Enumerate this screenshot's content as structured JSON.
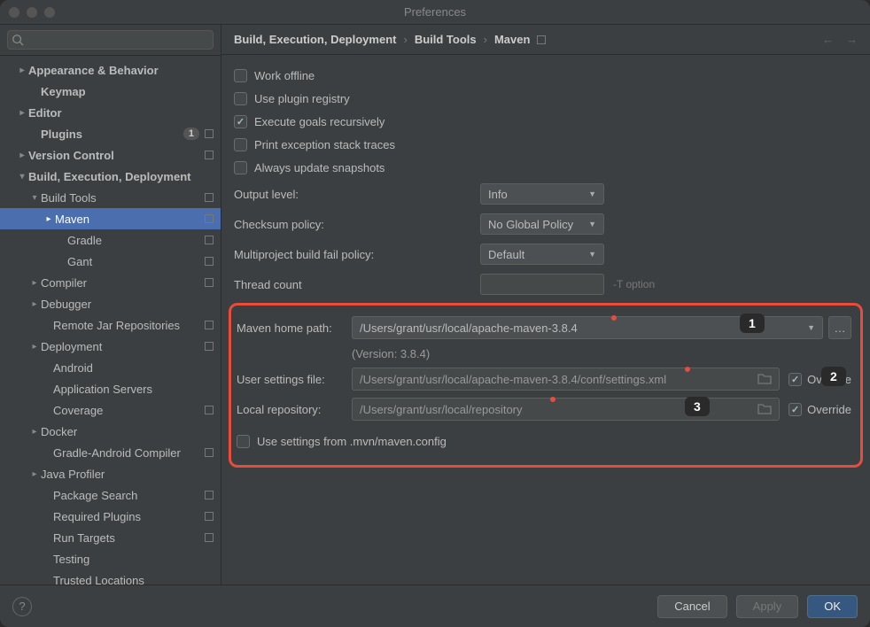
{
  "window": {
    "title": "Preferences"
  },
  "sidebar": {
    "search_placeholder": "",
    "items": [
      {
        "label": "Appearance & Behavior",
        "indent": 18,
        "bold": true,
        "chev": "right",
        "sq": false
      },
      {
        "label": "Keymap",
        "indent": 32,
        "bold": true
      },
      {
        "label": "Editor",
        "indent": 18,
        "bold": true,
        "chev": "right"
      },
      {
        "label": "Plugins",
        "indent": 32,
        "bold": true,
        "badge": "1",
        "sq": true
      },
      {
        "label": "Version Control",
        "indent": 18,
        "bold": true,
        "chev": "right",
        "sq": true
      },
      {
        "label": "Build, Execution, Deployment",
        "indent": 18,
        "bold": true,
        "chev": "down"
      },
      {
        "label": "Build Tools",
        "indent": 32,
        "chev": "down",
        "sq": true
      },
      {
        "label": "Maven",
        "indent": 48,
        "chev": "right",
        "selected": true,
        "sq": true
      },
      {
        "label": "Gradle",
        "indent": 62,
        "sq": true
      },
      {
        "label": "Gant",
        "indent": 62,
        "sq": true
      },
      {
        "label": "Compiler",
        "indent": 32,
        "chev": "right",
        "sq": true
      },
      {
        "label": "Debugger",
        "indent": 32,
        "chev": "right"
      },
      {
        "label": "Remote Jar Repositories",
        "indent": 46,
        "sq": true
      },
      {
        "label": "Deployment",
        "indent": 32,
        "chev": "right",
        "sq": true
      },
      {
        "label": "Android",
        "indent": 46
      },
      {
        "label": "Application Servers",
        "indent": 46
      },
      {
        "label": "Coverage",
        "indent": 46,
        "sq": true
      },
      {
        "label": "Docker",
        "indent": 32,
        "chev": "right"
      },
      {
        "label": "Gradle-Android Compiler",
        "indent": 46,
        "sq": true
      },
      {
        "label": "Java Profiler",
        "indent": 32,
        "chev": "right"
      },
      {
        "label": "Package Search",
        "indent": 46,
        "sq": true
      },
      {
        "label": "Required Plugins",
        "indent": 46,
        "sq": true
      },
      {
        "label": "Run Targets",
        "indent": 46,
        "sq": true
      },
      {
        "label": "Testing",
        "indent": 46
      },
      {
        "label": "Trusted Locations",
        "indent": 46
      }
    ]
  },
  "breadcrumb": {
    "p1": "Build, Execution, Deployment",
    "p2": "Build Tools",
    "p3": "Maven"
  },
  "checks": {
    "work_offline": "Work offline",
    "use_plugin_registry": "Use plugin registry",
    "execute_goals": "Execute goals recursively",
    "print_exception": "Print exception stack traces",
    "always_update": "Always update snapshots"
  },
  "selects": {
    "output_level_label": "Output level:",
    "output_level_value": "Info",
    "checksum_label": "Checksum policy:",
    "checksum_value": "No Global Policy",
    "multiproject_label": "Multiproject build fail policy:",
    "multiproject_value": "Default",
    "thread_label": "Thread count",
    "thread_hint": "-T option"
  },
  "maven": {
    "home_label": "Maven home path:",
    "home_value": "/Users/grant/usr/local/apache-maven-3.8.4",
    "version": "(Version: 3.8.4)",
    "settings_label": "User settings file:",
    "settings_value": "/Users/grant/usr/local/apache-maven-3.8.4/conf/settings.xml",
    "repo_label": "Local repository:",
    "repo_value": "/Users/grant/usr/local/repository",
    "override": "Override",
    "use_settings": "Use settings from .mvn/maven.config",
    "badge1": "1",
    "badge2": "2",
    "badge3": "3"
  },
  "footer": {
    "cancel": "Cancel",
    "apply": "Apply",
    "ok": "OK"
  }
}
